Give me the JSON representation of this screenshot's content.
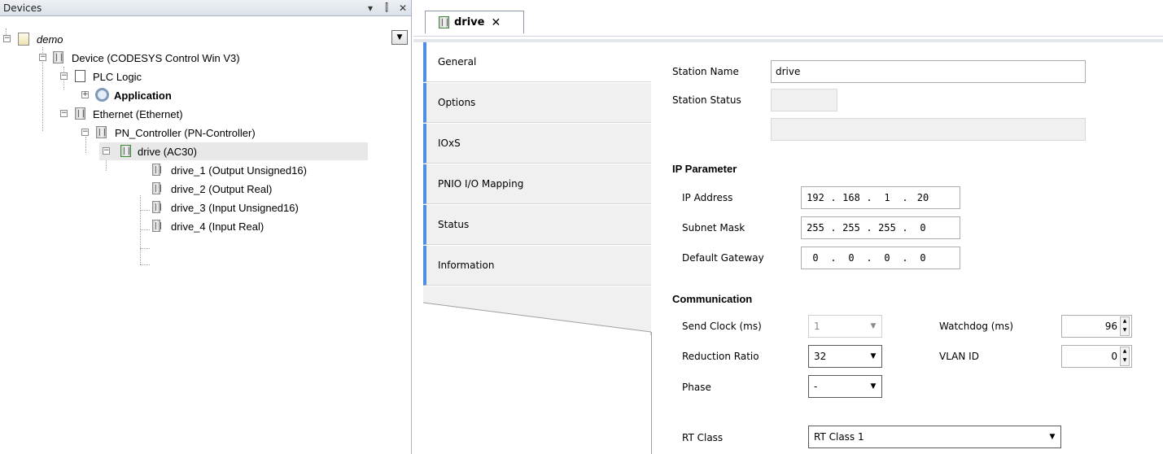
{
  "devices_panel": {
    "title": "Devices",
    "header_buttons": [
      "▾",
      "⫿",
      "✕"
    ],
    "tree": [
      {
        "label": "demo",
        "italic": true
      },
      {
        "label": "Device (CODESYS Control Win V3)"
      },
      {
        "label": "PLC Logic"
      },
      {
        "label": "Application",
        "bold": true
      },
      {
        "label": "Ethernet (Ethernet)"
      },
      {
        "label": "PN_Controller (PN-Controller)"
      },
      {
        "label": "drive (AC30)"
      },
      {
        "label": "drive_1 (Output Unsigned16)"
      },
      {
        "label": "drive_2 (Output Real)"
      },
      {
        "label": "drive_3 (Input Unsigned16)"
      },
      {
        "label": "drive_4 (Input Real)"
      }
    ]
  },
  "editor": {
    "tab_label": "drive",
    "tab_close": "✕",
    "vertical_tabs": [
      "General",
      "Options",
      "IOxS",
      "PNIO I/O Mapping",
      "Status",
      "Information"
    ],
    "active_tab": "General",
    "accent_color": "#4f8ee8",
    "form": {
      "station_name_label": "Station Name",
      "station_name_value": "drive",
      "station_status_label": "Station Status",
      "ip_section": "IP Parameter",
      "ip_address_label": "IP Address",
      "ip_address": [
        "192",
        "168",
        "1",
        "20"
      ],
      "subnet_label": "Subnet Mask",
      "subnet": [
        "255",
        "255",
        "255",
        "0"
      ],
      "gateway_label": "Default Gateway",
      "gateway": [
        "0",
        "0",
        "0",
        "0"
      ],
      "comm_section": "Communication",
      "send_clock_label": "Send Clock (ms)",
      "send_clock_value": "1",
      "watchdog_label": "Watchdog (ms)",
      "watchdog_value": "96",
      "reduction_label": "Reduction Ratio",
      "reduction_value": "32",
      "vlan_label": "VLAN ID",
      "vlan_value": "0",
      "phase_label": "Phase",
      "phase_value": "-",
      "rt_class_label": "RT Class",
      "rt_class_value": "RT Class 1"
    }
  }
}
